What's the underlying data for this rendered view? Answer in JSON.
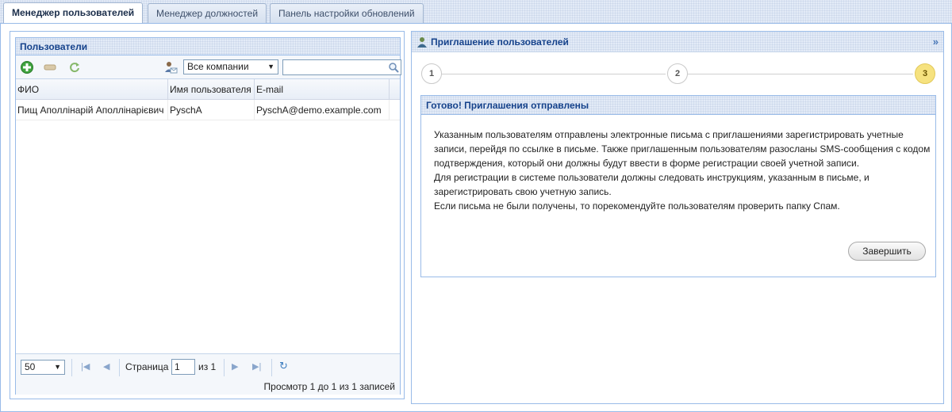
{
  "tabs": [
    {
      "label": "Менеджер пользователей"
    },
    {
      "label": "Менеджер должностей"
    },
    {
      "label": "Панель настройки обновлений"
    }
  ],
  "users_panel": {
    "title": "Пользователи",
    "company_filter": "Все компании",
    "search_value": "",
    "columns": [
      "ФИО",
      "Имя пользователя",
      "E-mail"
    ],
    "rows": [
      {
        "name": "Пищ Аполлінарій Аполлінарієвич",
        "username": "PyschA",
        "email": "PyschA@demo.example.com"
      }
    ],
    "pager": {
      "page_size": "50",
      "page_label": "Страница",
      "page_value": "1",
      "of_label": "из 1",
      "summary": "Просмотр 1 до 1 из 1 записей"
    }
  },
  "invite_panel": {
    "title": "Приглашение пользователей",
    "steps": [
      "1",
      "2",
      "3"
    ],
    "active_step": 3,
    "result_title": "Готово! Приглашения отправлены",
    "message_lines": [
      "Указанным пользователям отправлены электронные письма с приглашениями зарегистрировать учетные",
      "записи, перейдя по ссылке в письме. Также приглашенным пользователям разосланы SMS-сообщения с кодом",
      "подтверждения, который они должны будут ввести в форме регистрации своей учетной записи.",
      "Для регистрации в системе пользователи должны следовать инструкциям, указанным в письме, и",
      "зарегистрировать свою учетную запись.",
      "Если письма не были получены, то порекомендуйте пользователям проверить папку Спам."
    ],
    "finish_label": "Завершить"
  },
  "colors": {
    "header_text": "#15428b",
    "border": "#99bbe8",
    "active_step": "#f6e27f"
  }
}
